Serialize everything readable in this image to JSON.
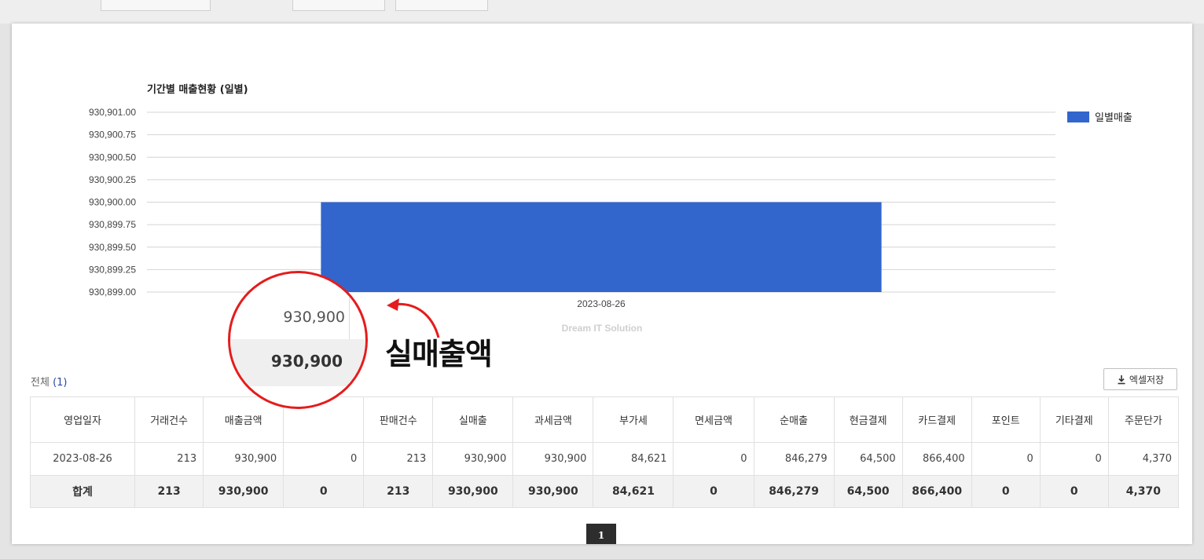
{
  "chart_data": {
    "type": "bar",
    "title": "기간별 매출현황 (일별)",
    "categories": [
      "2023-08-26"
    ],
    "series": [
      {
        "name": "일별매출",
        "values": [
          930900
        ],
        "color": "#3366cc"
      }
    ],
    "ylim": [
      930899.0,
      930901.0
    ],
    "yticks": [
      "930,901.00",
      "930,900.75",
      "930,900.50",
      "930,900.25",
      "930,900.00",
      "930,899.75",
      "930,899.50",
      "930,899.25",
      "930,899.00"
    ],
    "xlabel": "",
    "ylabel": "",
    "grid": true,
    "legend": "top-right",
    "credit": "Dream IT Solution"
  },
  "summary": {
    "total_label": "전체",
    "total_count": "(1)",
    "excel_button": "엑셀저장",
    "excel_icon": "download-icon"
  },
  "table": {
    "headers": [
      "영업일자",
      "거래건수",
      "매출금액",
      "",
      "판매건수",
      "실매출",
      "과세금액",
      "부가세",
      "면세금액",
      "순매출",
      "현금결제",
      "카드결제",
      "포인트",
      "기타결제",
      "주문단가"
    ],
    "rows": [
      [
        "2023-08-26",
        "213",
        "930,900",
        "0",
        "213",
        "930,900",
        "930,900",
        "84,621",
        "0",
        "846,279",
        "64,500",
        "866,400",
        "0",
        "0",
        "4,370"
      ]
    ],
    "sum_row": [
      "합계",
      "213",
      "930,900",
      "0",
      "213",
      "930,900",
      "930,900",
      "84,621",
      "0",
      "846,279",
      "64,500",
      "866,400",
      "0",
      "0",
      "4,370"
    ]
  },
  "pagination": {
    "current": "1"
  },
  "annotation": {
    "zoom_value": "930,900",
    "zoom_sum_value": "930,900",
    "callout_text": "실매출액",
    "color": "#e51c1c"
  }
}
